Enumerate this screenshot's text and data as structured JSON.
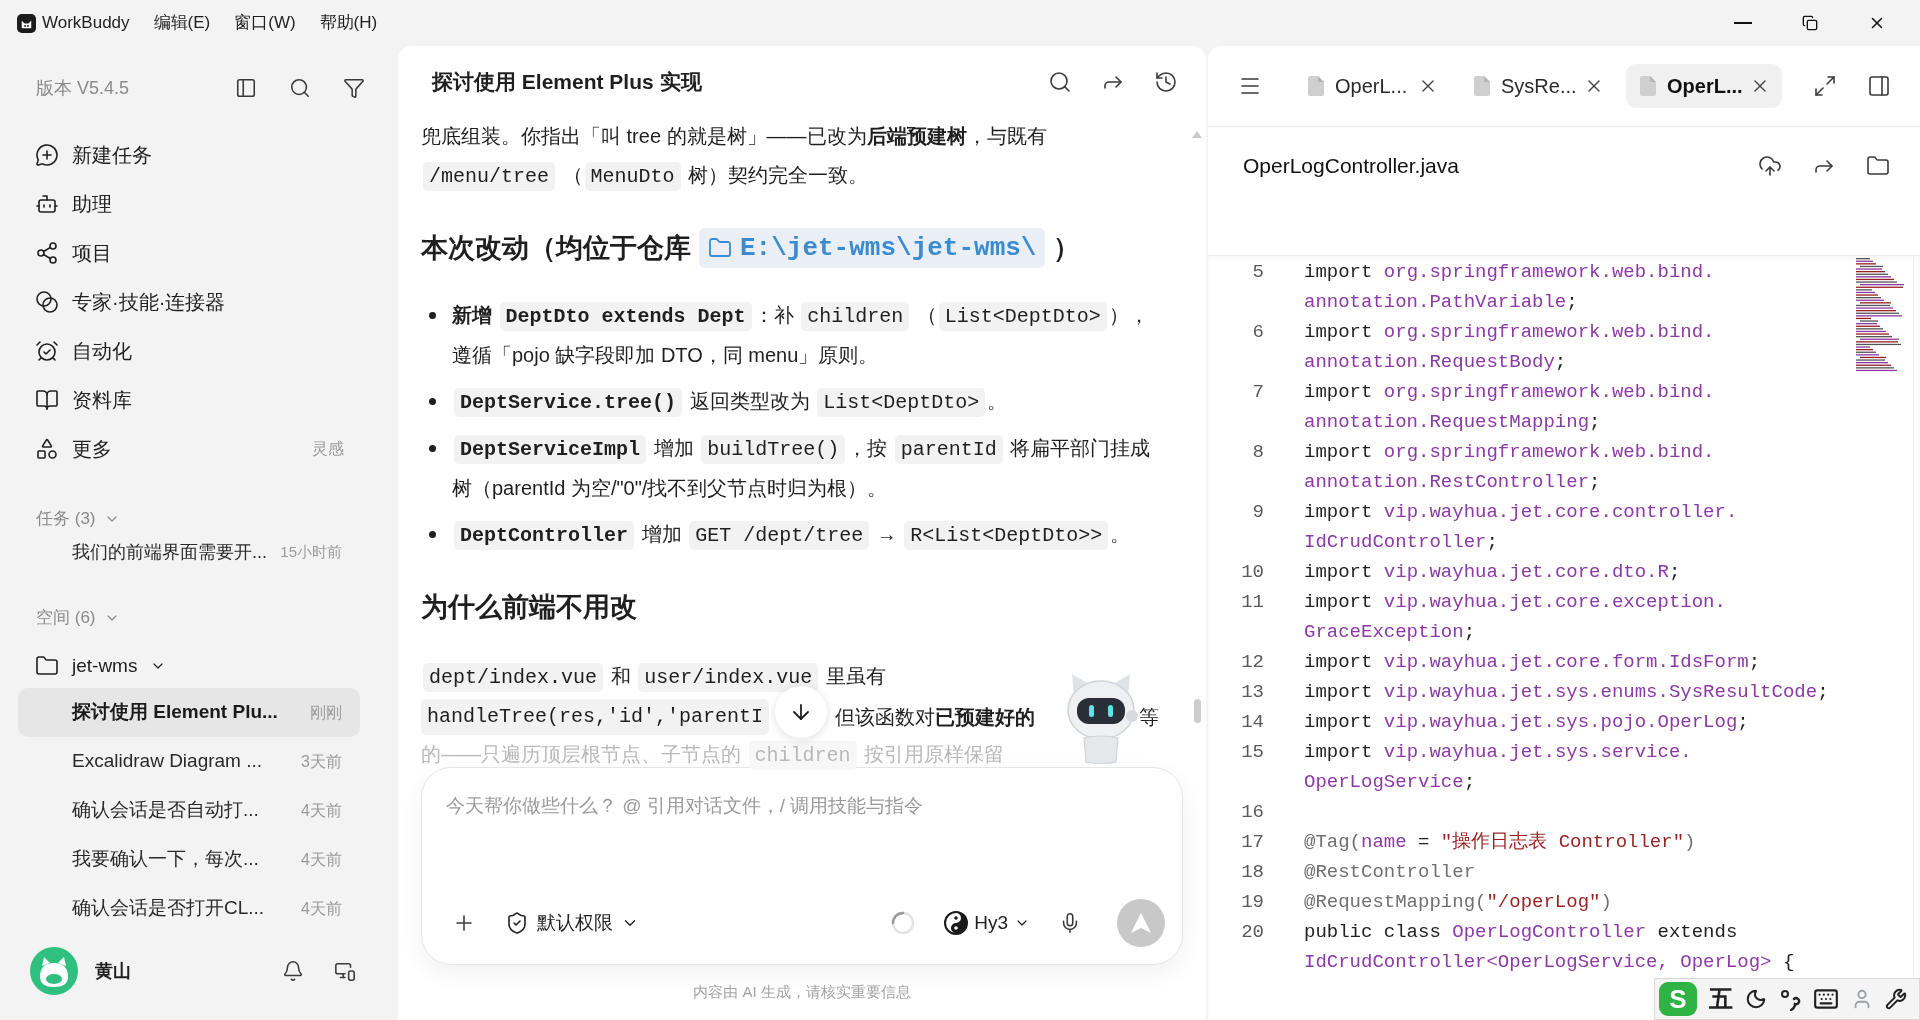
{
  "title_bar": {
    "app_name": "WorkBuddy",
    "menus": [
      "编辑(E)",
      "窗口(W)",
      "帮助(H)"
    ]
  },
  "sidebar": {
    "version": "版本 V5.4.5",
    "nav": [
      {
        "label": "新建任务"
      },
      {
        "label": "助理"
      },
      {
        "label": "项目"
      },
      {
        "label": "专家·技能·连接器"
      },
      {
        "label": "自动化"
      },
      {
        "label": "资料库"
      },
      {
        "label": "更多",
        "hint": "灵感"
      }
    ],
    "tasks": {
      "label": "任务 (3)",
      "expanded": true,
      "items": [
        {
          "title": "我们的前端界面需要开...",
          "time": "15小时前",
          "selected": false
        }
      ]
    },
    "spaces": {
      "label": "空间 (6)",
      "expanded": true,
      "folders": [
        {
          "name": "jet-wms",
          "expanded": true,
          "items": [
            {
              "title": "探讨使用 Element Plu...",
              "time": "刚刚",
              "selected": true
            },
            {
              "title": "Excalidraw Diagram ...",
              "time": "3天前",
              "selected": false
            },
            {
              "title": "确认会话是否自动打...",
              "time": "4天前",
              "selected": false
            },
            {
              "title": "我要确认一下，每次...",
              "time": "4天前",
              "selected": false
            },
            {
              "title": "确认会话是否打开CL...",
              "time": "4天前",
              "selected": false
            }
          ]
        }
      ]
    },
    "user": {
      "name": "黄山"
    }
  },
  "chat": {
    "title": "探讨使用 Element Plus 实现",
    "blocks": [
      {
        "kind": "paragraph",
        "parts": [
          {
            "kind": "text",
            "text": "兜底组装。你指出「叫 tree 的就是树」——已改为**后端预建树**，与既有 "
          },
          {
            "kind": "code",
            "text": "/menu/tree",
            "bold": false
          },
          {
            "kind": "text",
            "text": " （"
          },
          {
            "kind": "code",
            "text": "MenuDto",
            "bold": false
          },
          {
            "kind": "text",
            "text": " 树）契约完全一致。"
          }
        ]
      },
      {
        "kind": "heading",
        "parts": [
          {
            "kind": "text",
            "text": "本次改动（均位于仓库"
          },
          {
            "kind": "path",
            "text": "E:\\jet-wms\\jet-wms\\"
          },
          {
            "kind": "text",
            "text": "）"
          }
        ]
      },
      {
        "kind": "bullets",
        "items": [
          {
            "parts": [
              {
                "kind": "text",
                "text": "**新增** "
              },
              {
                "kind": "code",
                "text": "DeptDto extends Dept",
                "bold": true
              },
              {
                "kind": "text",
                "text": "：补 "
              },
              {
                "kind": "code",
                "text": "children",
                "bold": false
              },
              {
                "kind": "text",
                "text": " （"
              },
              {
                "kind": "code",
                "text": "List<DeptDto>",
                "bold": false
              },
              {
                "kind": "text",
                "text": "），遵循「pojo 缺字段即加 DTO，同 menu」原则。"
              }
            ]
          },
          {
            "parts": [
              {
                "kind": "code",
                "text": "DeptService.tree()",
                "bold": true
              },
              {
                "kind": "text",
                "text": " 返回类型改为 "
              },
              {
                "kind": "code",
                "text": "List<DeptDto>",
                "bold": false
              },
              {
                "kind": "text",
                "text": "。"
              }
            ]
          },
          {
            "parts": [
              {
                "kind": "code",
                "text": "DeptServiceImpl",
                "bold": true
              },
              {
                "kind": "text",
                "text": " 增加 "
              },
              {
                "kind": "code",
                "text": "buildTree()",
                "bold": false
              },
              {
                "kind": "text",
                "text": "，按 "
              },
              {
                "kind": "code",
                "text": "parentId",
                "bold": false
              },
              {
                "kind": "text",
                "text": " 将扁平部门挂成树（parentId 为空/\"0\"/找不到父节点时归为根）。"
              }
            ]
          },
          {
            "parts": [
              {
                "kind": "code",
                "text": "DeptController",
                "bold": true
              },
              {
                "kind": "text",
                "text": " 增加 "
              },
              {
                "kind": "code",
                "text": "GET /dept/tree",
                "bold": false
              },
              {
                "kind": "text",
                "text": " → "
              },
              {
                "kind": "code",
                "text": "R<List<DeptDto>>",
                "bold": false
              },
              {
                "kind": "text",
                "text": "。"
              }
            ]
          }
        ]
      },
      {
        "kind": "heading",
        "parts": [
          {
            "kind": "text",
            "text": "为什么前端不用改"
          }
        ]
      },
      {
        "kind": "paragraph",
        "parts": [
          {
            "kind": "code",
            "text": "dept/index.vue",
            "bold": false
          },
          {
            "kind": "text",
            "text": " 和 "
          },
          {
            "kind": "code",
            "text": "user/index.vue",
            "bold": false
          },
          {
            "kind": "text",
            "text": " 里虽有"
          }
        ]
      },
      {
        "kind": "covered_line",
        "pieces": [
          {
            "kind": "code",
            "text": "handleTree(res,'id','parentI",
            "bold": false
          },
          {
            "kind": "text",
            "text": "但该函数对**已预建好的**"
          },
          {
            "kind": "text",
            "text": "等"
          }
        ]
      },
      {
        "kind": "faded_line",
        "parts": [
          {
            "kind": "text",
            "text": "的——只遍历顶层根节点、子节点的 "
          },
          {
            "kind": "code",
            "text": "children",
            "bold": false
          },
          {
            "kind": "text",
            "text": " 按引用原样保留"
          }
        ]
      }
    ],
    "composer": {
      "placeholder": "今天帮你做些什么？ @ 引用对话文件，/ 调用技能与指令",
      "permission": "默认权限",
      "model": "Hy3",
      "busy": true,
      "send_disabled": true
    },
    "footnote": "内容由 AI 生成，请核实重要信息"
  },
  "editor": {
    "tabs": [
      {
        "label": "OperL...",
        "selected": false
      },
      {
        "label": "SysRe...",
        "selected": false
      },
      {
        "label": "OperL...",
        "selected": true
      }
    ],
    "file_name": "OperLogController.java",
    "code_lines": [
      {
        "number": "5",
        "tokens": [
          {
            "kind": "plain",
            "text": "import "
          },
          {
            "kind": "type",
            "text": "org.springframework.web.bind.annotation.PathVariable"
          },
          {
            "kind": "plain",
            "text": ";"
          }
        ]
      },
      {
        "number": "6",
        "tokens": [
          {
            "kind": "plain",
            "text": "import "
          },
          {
            "kind": "type",
            "text": "org.springframework.web.bind.annotation.RequestBody"
          },
          {
            "kind": "plain",
            "text": ";"
          }
        ]
      },
      {
        "number": "7",
        "tokens": [
          {
            "kind": "plain",
            "text": "import "
          },
          {
            "kind": "type",
            "text": "org.springframework.web.bind.annotation.RequestMapping"
          },
          {
            "kind": "plain",
            "text": ";"
          }
        ]
      },
      {
        "number": "8",
        "tokens": [
          {
            "kind": "plain",
            "text": "import "
          },
          {
            "kind": "type",
            "text": "org.springframework.web.bind.annotation.RestController"
          },
          {
            "kind": "plain",
            "text": ";"
          }
        ]
      },
      {
        "number": "9",
        "tokens": [
          {
            "kind": "plain",
            "text": "import "
          },
          {
            "kind": "type",
            "text": "vip.wayhua.jet.core.controller.IdCrudController"
          },
          {
            "kind": "plain",
            "text": ";"
          }
        ]
      },
      {
        "number": "10",
        "tokens": [
          {
            "kind": "plain",
            "text": "import "
          },
          {
            "kind": "type",
            "text": "vip.wayhua.jet.core.dto.R"
          },
          {
            "kind": "plain",
            "text": ";"
          }
        ]
      },
      {
        "number": "11",
        "tokens": [
          {
            "kind": "plain",
            "text": "import "
          },
          {
            "kind": "type",
            "text": "vip.wayhua.jet.core.exception.GraceException"
          },
          {
            "kind": "plain",
            "text": ";"
          }
        ]
      },
      {
        "number": "12",
        "tokens": [
          {
            "kind": "plain",
            "text": "import "
          },
          {
            "kind": "type",
            "text": "vip.wayhua.jet.core.form.IdsForm"
          },
          {
            "kind": "plain",
            "text": ";"
          }
        ]
      },
      {
        "number": "13",
        "tokens": [
          {
            "kind": "plain",
            "text": "import "
          },
          {
            "kind": "type",
            "text": "vip.wayhua.jet.sys.enums.SysResultCode"
          },
          {
            "kind": "plain",
            "text": ";"
          }
        ]
      },
      {
        "number": "14",
        "tokens": [
          {
            "kind": "plain",
            "text": "import "
          },
          {
            "kind": "type",
            "text": "vip.wayhua.jet.sys.pojo.OperLog"
          },
          {
            "kind": "plain",
            "text": ";"
          }
        ]
      },
      {
        "number": "15",
        "tokens": [
          {
            "kind": "plain",
            "text": "import "
          },
          {
            "kind": "type",
            "text": "vip.wayhua.jet.sys.service.OperLogService"
          },
          {
            "kind": "plain",
            "text": ";"
          }
        ]
      },
      {
        "number": "16"
      },
      {
        "number": "17",
        "tokens": [
          {
            "kind": "annotation",
            "text": "@Tag("
          },
          {
            "kind": "type",
            "text": "name"
          },
          {
            "kind": "plain",
            "text": " = "
          },
          {
            "kind": "string",
            "text": "\"操作日志表 Controller\""
          },
          {
            "kind": "annotation",
            "text": ")"
          }
        ]
      },
      {
        "number": "18",
        "tokens": [
          {
            "kind": "annotation",
            "text": "@RestController"
          }
        ]
      },
      {
        "number": "19",
        "tokens": [
          {
            "kind": "annotation",
            "text": "@RequestMapping("
          },
          {
            "kind": "string",
            "text": "\"/operLog\""
          },
          {
            "kind": "annotation",
            "text": ")"
          }
        ]
      },
      {
        "number": "20",
        "tokens": [
          {
            "kind": "plain",
            "text": "public class "
          },
          {
            "kind": "type",
            "text": "OperLogController"
          },
          {
            "kind": "plain",
            "text": " extends "
          },
          {
            "kind": "type",
            "text": "IdCrudController<OperLogService, OperLog>"
          },
          {
            "kind": "plain",
            "text": " {"
          }
        ]
      }
    ]
  },
  "ime_bar": {
    "logo": "S",
    "mode": "五"
  }
}
